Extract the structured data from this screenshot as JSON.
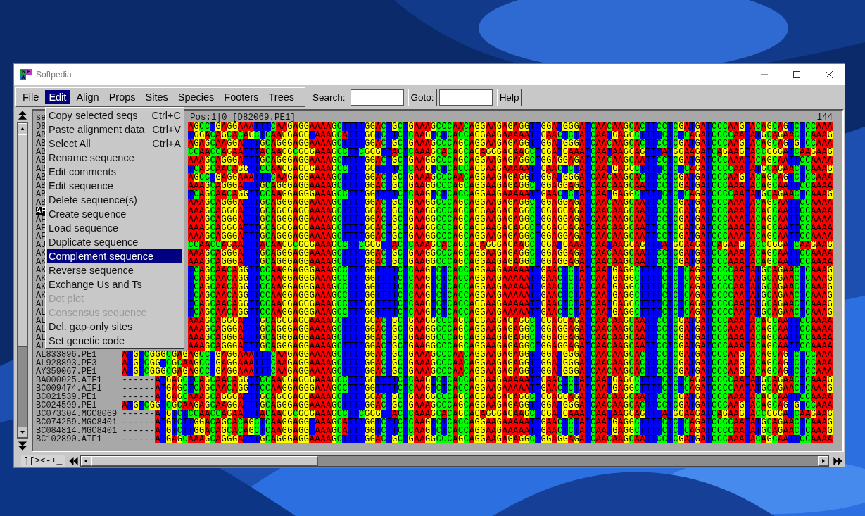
{
  "window": {
    "title": "Softpedia",
    "icon_letters": [
      "S",
      "E",
      "A"
    ]
  },
  "menubar": [
    {
      "label": "File",
      "selected": false
    },
    {
      "label": "Edit",
      "selected": true
    },
    {
      "label": "Align",
      "selected": false
    },
    {
      "label": "Props",
      "selected": false
    },
    {
      "label": "Sites",
      "selected": false
    },
    {
      "label": "Species",
      "selected": false
    },
    {
      "label": "Footers",
      "selected": false
    },
    {
      "label": "Trees",
      "selected": false
    }
  ],
  "search": {
    "label": "Search:"
  },
  "goto": {
    "label": "Goto:"
  },
  "help": {
    "label": "Help"
  },
  "edit_menu": [
    {
      "label": "Copy selected seqs",
      "shortcut": "Ctrl+C",
      "disabled": false,
      "selected": false
    },
    {
      "label": "Paste alignment data",
      "shortcut": "Ctrl+V",
      "disabled": false,
      "selected": false
    },
    {
      "label": "Select All",
      "shortcut": "Ctrl+A",
      "disabled": false,
      "selected": false
    },
    {
      "label": "Rename sequence",
      "disabled": false,
      "selected": false
    },
    {
      "label": "Edit comments",
      "disabled": false,
      "selected": false
    },
    {
      "label": "Edit sequence",
      "disabled": false,
      "selected": false
    },
    {
      "label": "Delete sequence(s)",
      "disabled": false,
      "selected": false
    },
    {
      "label": "Create sequence",
      "disabled": false,
      "selected": false
    },
    {
      "label": "Load sequence",
      "disabled": false,
      "selected": false
    },
    {
      "label": "Duplicate sequence",
      "disabled": false,
      "selected": false
    },
    {
      "label": "Complement sequence",
      "disabled": false,
      "selected": true
    },
    {
      "label": "Reverse sequence",
      "disabled": false,
      "selected": false
    },
    {
      "label": "Exchange Us and Ts",
      "disabled": false,
      "selected": false
    },
    {
      "label": "Dot plot",
      "disabled": true,
      "selected": false
    },
    {
      "label": "Consensus sequence",
      "disabled": true,
      "selected": false
    },
    {
      "label": "Del. gap-only sites",
      "disabled": false,
      "selected": false
    },
    {
      "label": "Set genetic code",
      "disabled": false,
      "selected": false
    }
  ],
  "alignment": {
    "names_header": "se",
    "position": "Pos:1|0 [D82069.PE1]",
    "length": "144",
    "rows": [
      {
        "name": "D8",
        "selected": false,
        "residues": "AGCCTGAGGAAATTTCAAGAGGAAAAGCTTTTGGACTGCTGAAAGCCCAACAGGAAGAGAGGTTGGATGGGATCAACAAGCACTTCCTCGATGATCCCAAGTACAGCAGTCTCCAAA"
      },
      {
        "name": "AB",
        "selected": false,
        "residues": "TGGACAGCACAGCTCAAGGAGGTAAAGCATTTGGTCTTCTCAAGTCTCACCAGGAAGAAAAATTGAACTCTATCAATGAGGCTTTTCTCTCAGATCCCCAATATGCAGAACTCAAAG"
      },
      {
        "name": "AB",
        "selected": false,
        "residues": "AGAGCAAGGATTTGCAGGGAGGAAAAGCTTTTGGACTGCTGAAAGCCCAGCAGGAAGAGAGGTTGGATGGGATCAACAAGCACTTCCTCGATGATCCCAAGTACAGCAGTGTCCAAA"
      },
      {
        "name": "AB",
        "selected": false,
        "residues": "CCAACCAGAATTTACAAGGCGGGAAAGCCTTCGGGTTACTCAAAGCACAGCAGAGGGAGAAGCTGGATGAAATCAATAAGGAGTTTATGGAAGATCAGAAGTACCGGGATCAAGAAG"
      },
      {
        "name": "AB",
        "selected": false,
        "residues": "AAAGCAGGGATTTGCAGGGAGGAAAAGCTTTTGGACTGCTGAAGGCCCAGCAGGAAGAGAGGCTGGAGGAGATCAACAAGCAATTCCTCGATGATCCCAAATACAGCAATTCCAAAA"
      },
      {
        "name": "AB",
        "selected": false,
        "residues": "TCAGCAACAGGTTCCAAGGAGGGAAAGCCTTTGGTTTTCTCAAGTCTCACCAGGAAGAAAAATTGAACTCTATCAATGAGGCTTTTCTCTCAGATCCCCAATATGCAGAACTCAAAG"
      },
      {
        "name": "AB",
        "selected": false,
        "residues": "AGCCTGAGGAAATTTCAAGAGGAAAAGCTTTTGGACTGCTGAAAGCCCAACAGGAAGAGAGGTTGGATGGGATCAACAAGCACTTCCTCGATGATCCCAAGTACAGCAGTCTCCAAA"
      },
      {
        "name": "AB",
        "selected": false,
        "residues": "AAAGCAGGGATTTGCAGGGAGGAAAAGCTTTTGGACTGCTGAAGGCCCAGCAGGAAGAGAGGCTGGAGGAGATCAACAAGCAATTCCTCGATGATCCCAAATACAGCAATTCCAAAA"
      },
      {
        "name": "AB",
        "selected": false,
        "residues": "TCAGCAACAGGTTCCAAGGAGGGAAAGCCTTTGGTTTTCTCAAGTCTCACCAGGAAGAAAAATTGAACTCTATCAATGAGGCTTTTCTCTCAGATCCCCAATATGCAGAACTCAAAG"
      },
      {
        "name": "AB",
        "selected": false,
        "residues": "AAAGCAGGGATTTGCAGGGAGGAAAAGCTTTTGGACTGCTGAAGGCCCAGCAGGAAGAGAGGCTGGAGGAGATCAACAAGCAATTCCTCGATGATCCCAAATACAGCAATTCCAAAA"
      },
      {
        "name": "AF",
        "selected": true,
        "residues": "AAAGCAGGGATTTGCAGGGAGGAAAAGCTTTTGGACTGCTGAAGGCCCAGCAGGAAGAGAGGCTGGAGGAGATCAACAAGCAATTCCTCGATGATCCCAAATACAGCAATTCCAAAA"
      },
      {
        "name": "AF",
        "selected": false,
        "residues": "AAAGCAGGGATTTGCAGGGAGGAAAAGCTTTTGGACTGCTGAAGGCCCAGCAGGAAGAGAGGCTGGAGGAGATCAACAAGCAATTCCTCGATGATCCCAAATACAGCAATTCCAAAA"
      },
      {
        "name": "AF",
        "selected": false,
        "residues": "AAAGCAGGGATTTGCAGGGAGGAAAAGCTTTTGGACTGCTGAAGGCCCAGCAGGAAGAGAGGCTGGAGGAGATCAACAAGCAATTCCTCGATGATCCCAAATACAGCAATTCCAAAA"
      },
      {
        "name": "AF",
        "selected": false,
        "residues": "AAAGCAGGGATTTGCAGGGAGGAAAAGCTTTTGGACTGCTGAAGGCCCAGCAGGAAGAGAGGCTGGAGGAGATCAACAAGCAATTCCTCGATGATCCCAAATACAGCAATTCCAAAA"
      },
      {
        "name": "AJ",
        "selected": false,
        "residues": "CCAACCAGAATTTACAAGGCGGGAAAGCCTTCGGGTTACTCAAAGCACAGCAGAGGGAGAAGCTGGATGAAATCAATAAGGAGTTTATGGAAGATCAGAAGTACCGGGATCAAGAAG"
      },
      {
        "name": "AK",
        "selected": false,
        "residues": "AAAGCAGGGATTTGCAGGGAGGAAAAGCTTTTGGACTGCTGAAGGCCCAGCAGGAAGAGAGGCTGGAGGAGATCAACAAGCAATTCCTCGATGATCCCAAATACAGCAATTCCAAAA"
      },
      {
        "name": "AK",
        "selected": false,
        "residues": "AAAGCAGGGATTTGCAGGGAGGAAAAGCTTTTGGACTGCTGAAGGCCCAGCAGGAAGAGAGGCTGGAGGAGATCAACAAGCAATTCCTCGATGATCCCAAATACAGCAATTCCAAAA"
      },
      {
        "name": "AK",
        "selected": false,
        "residues": "TCAGCAACAGGTTCCAAGGAGGGAAAGCCTTTGGTTTTCTCAAGTCTCACCAGGAAGAAAAATTGAACTCTATCAATGAGGCTTTTCTCTCAGATCCCCAATATGCAGAACTCAAAG"
      },
      {
        "name": "AK",
        "selected": false,
        "residues": "TCAGCAACAGGTTCCAAGGAGGGAAAGCCTTTGGTTTTCTCAAGTCTCACCAGGAAGAAAAATTGAACTCTATCAATGAGGCTTTTCTCTCAGATCCCCAATATGCAGAACTCAAAG"
      },
      {
        "name": "AK",
        "selected": false,
        "residues": "TCAGCAACAGGTTCCAAGGAGGGAAAGCCTTTGGTTTTCTCAAGTCTCACCAGGAAGAAAAATTGAACTCTATCAATGAGGCTTTTCTCTCAGATCCCCAATATGCAGAACTCAAAG"
      },
      {
        "name": "AK",
        "selected": false,
        "residues": "TCAGCAACAGGTTCCAAGGAGGGAAAGCCTTTGGTTTTCTCAAGTCTCACCAGGAAGAAAAATTGAACTCTATCAATGAGGCTTTTCTCTCAGATCCCCAATATGCAGAACTCAAAG"
      },
      {
        "name": "AL",
        "selected": false,
        "residues": "TCAGCAACAGGTTCCAAGGAGGGAAAGCCTTTGGTTTTCTCAAGTCTCACCAGGAAGAAAAATTGAACTCTATCAATGAGGCTTTTCTCTCAGATCCCCAATATGCAGAACTCAAAG"
      },
      {
        "name": "AL",
        "selected": false,
        "residues": "TCAGCAACAGGTTCCAAGGAGGGAAAGCCTTTGGTTTTCTCAAGTCTCACCAGGAAGAAAAATTGAACTCTATCAATGAGGCTTTTCTCTCAGATCCCCAATATGCAGAACTCAAAG"
      },
      {
        "name": "AL",
        "selected": false,
        "residues": "AAAGCAGGGATTTGCAGGGAGGAAAAGCTTTTGGACTGCTGAAGGCCCAGCAGGAAGAGAGGCTGGAGGAGATCAACAAGCAATTCCTCGATGATCCCAAATACAGCAATTCCAAAA"
      },
      {
        "name": "AL",
        "selected": false,
        "residues": "AAAGCAGGGATTTGCAGGGAGGAAAAGCTTTTGGACTGCTGAAGGCCCAGCAGGAAGAGAGGCTGGAGGAGATCAACAAGCAATTCCTCGATGATCCCAAATACAGCAATTCCAAAA"
      },
      {
        "name": "AL",
        "selected": false,
        "residues": "AAAGCAGGGATTTGCAGGGAGGAAAAGCTTTTGGACTGCTGAAGGCCCAGCAGGAAGAGAGGCTGGAGGAGATCAACAAGCAATTCCTCGATGATCCCAAATACAGCAATTCCAAAA"
      },
      {
        "name": "AL",
        "selected": false,
        "residues": "AAAGCAGGGATTTGCAGGGAGGAAAAGCTTTTGGACTGCTGAAGGCCCAGCAGGAAGAGAGGCTGGAGGAGATCAACAAGCAATTCCTCGATGATCCCAAATACAGCAATTCCAAAA"
      },
      {
        "name": "AL833896.PE1",
        "selected": false,
        "residues": "ATGTCGGGCGAGAGCCTGAGGAAATTTCAAGAGGAAAAGCTTTTGGACTGCTGAAAGCCCAACAGGAAGAGAGGTTGGATGGGATCAACAAGCACTTCCTCGATGATCCCAAGTACAGCAGTCTCCAAA"
      },
      {
        "name": "AL928893.PE3",
        "selected": false,
        "residues": "ATGTCGGTCGCAAGCCTGAGGAAATTTCAAGAGGAAAAGCTTTTGGACTGCTGAAAGCCCAACAGGAAGAGAGGTTGGATGGGATCAACAAGCACTTCCTCGATGATCCCAAGTACAGCAGTCTCCAAA"
      },
      {
        "name": "AY359067.PE1",
        "selected": false,
        "residues": "ATGTCGGGCGAGAGCCTGAGGAAATTTCAAGAGGAAAAGCTTTTGGACTGCTGAAAGCCCAACAGGAAGAGAGGTTGGATGGGATCAACAAGCACTTCCTCGATGATCCCAAGTACAGCAGTCTCCAAA"
      },
      {
        "name": "BA000025.AIF1",
        "selected": false,
        "residues": "------ATGAGCTCAGCAACAGGTTCCAAGGAGGGAAAGCCTTTGGTTTTCTCAAGTCTCACCAGGAAGAAAAATTGAACTCTATCAATGAGGCTTTTCTCTCAGATCCCCAATATGCAGAACTCAAAG"
      },
      {
        "name": "BC009474.AIF1",
        "selected": false,
        "residues": "------ATGAGCTCAGCAACAGGTTCCAAGGAGGGAAAGCCTTTGGTTTTCTCAAGTCTCACCAGGAAGAAAAATTGAACTCTATCAATGAGGCTTTTCTCTCAGATCCCCAATATGCAGAACTCAAAG"
      },
      {
        "name": "BC021539.PE1",
        "selected": false,
        "residues": "------ATGAGCAAAGCAGGGATTTGCAGGGAGGAAAAGCTTTTGGACTGCTGAAGGCCCAGCAGGAAGAGAGGCTGGAGGAGATCAACAAGCAATTCCTCGATGATCCCAAATACAGCAATTCCAAAA"
      },
      {
        "name": "BC024599.PE1",
        "selected": false,
        "residues": "ATGTCGGTCGCAAGAGCAAGGATTTGCAGGGAGGAAAAGCTTTTGGACTGCTGAAAGCCCAGCAGGAAGAGAGGTTGGATGGGATCAACAAGCACTTCCTCGATGATCCCAAGTACAGCAGTGTCCAAA"
      },
      {
        "name": "BC073304.MGC8069",
        "selected": false,
        "residues": "------ATGTCTCCAACCAGAATTTACAAGGCGGGAAAGCCTTCGGGTTACTCAAAGCACAGCAGAGGGAGAAGCTGGATGAAATCAATAAGGAGTTTATGGAAGATCAGAAGTACCGGGATCAAGAAG"
      },
      {
        "name": "BC074259.MGC8401",
        "selected": false,
        "residues": "------ATGTCTTGGACAGCACAGCTCAAGGAGGTAAAGCATTTGGTCTTCTCAAGTCTCACCAGGAAGAAAAATTGAACTCTATCAATGAGGCTTTTCTCTCAGATCCCCAATATGCAGAACTCAAAG"
      },
      {
        "name": "BC084814.MGC8401",
        "selected": false,
        "residues": "------ATGTCTTGGACAGCACAGCTCAAGGAGGTAAAGCATTTGGTCTTCTCAAGTCTCACCAGGAAGAAAAATTGAACTCTATCAATGAGGCTTTTCTCTCAGATCCCCAATATGCAGAACTCAAAG"
      },
      {
        "name": "BC102890.AIF1",
        "selected": false,
        "residues": "------ATGAGCAAAGCAGGGATTTGCAGGGAGGAAAAGCTTTTGGACTGCTGAAGGCCCAGCAGGAAGAGAGGCTGGAGGAGATCAACAAGCAATTCCTCGATGATCCCAAATACAGCAATTCCAAAA"
      }
    ]
  },
  "bottom_bar": {
    "tools": "][><-+_"
  }
}
